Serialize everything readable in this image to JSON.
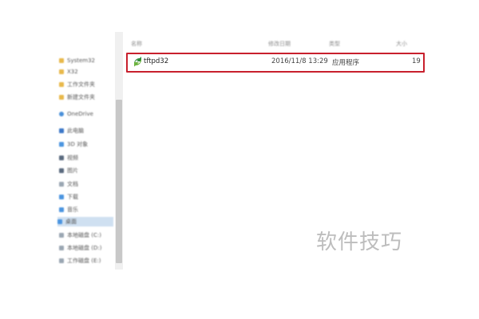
{
  "columns": {
    "name": "名称",
    "date": "修改日期",
    "type": "类型",
    "size": "大小"
  },
  "sidebar": {
    "items": [
      {
        "label": "System32",
        "icon": "folder-icon"
      },
      {
        "label": "X32",
        "icon": "folder-icon"
      },
      {
        "label": "工作文件夹",
        "icon": "folder-icon"
      },
      {
        "label": "新建文件夹",
        "icon": "folder-icon"
      },
      {
        "label": "OneDrive",
        "icon": "cloud-icon"
      },
      {
        "label": "此电脑",
        "icon": "pc-icon"
      },
      {
        "label": "3D 对象",
        "icon": "drive-icon"
      },
      {
        "label": "视频",
        "icon": "video-icon"
      },
      {
        "label": "图片",
        "icon": "picture-icon"
      },
      {
        "label": "文档",
        "icon": "document-icon"
      },
      {
        "label": "下载",
        "icon": "download-icon"
      },
      {
        "label": "音乐",
        "icon": "music-icon"
      },
      {
        "label": "桌面",
        "icon": "desktop-icon",
        "selected": true
      },
      {
        "label": "本地磁盘 (C:)",
        "icon": "disk-icon"
      },
      {
        "label": "本地磁盘 (D:)",
        "icon": "disk-icon"
      },
      {
        "label": "工作磁盘 (E:)",
        "icon": "disk-icon"
      }
    ]
  },
  "files": [
    {
      "name": "tftpd32",
      "date": "2016/11/8 13:29",
      "type": "应用程序",
      "size": "19",
      "icon": "tftpd32-app-icon"
    }
  ],
  "watermark": "软件技巧",
  "colors": {
    "highlight_border": "#c8202d",
    "selected_nav": "#cfe0f1"
  }
}
